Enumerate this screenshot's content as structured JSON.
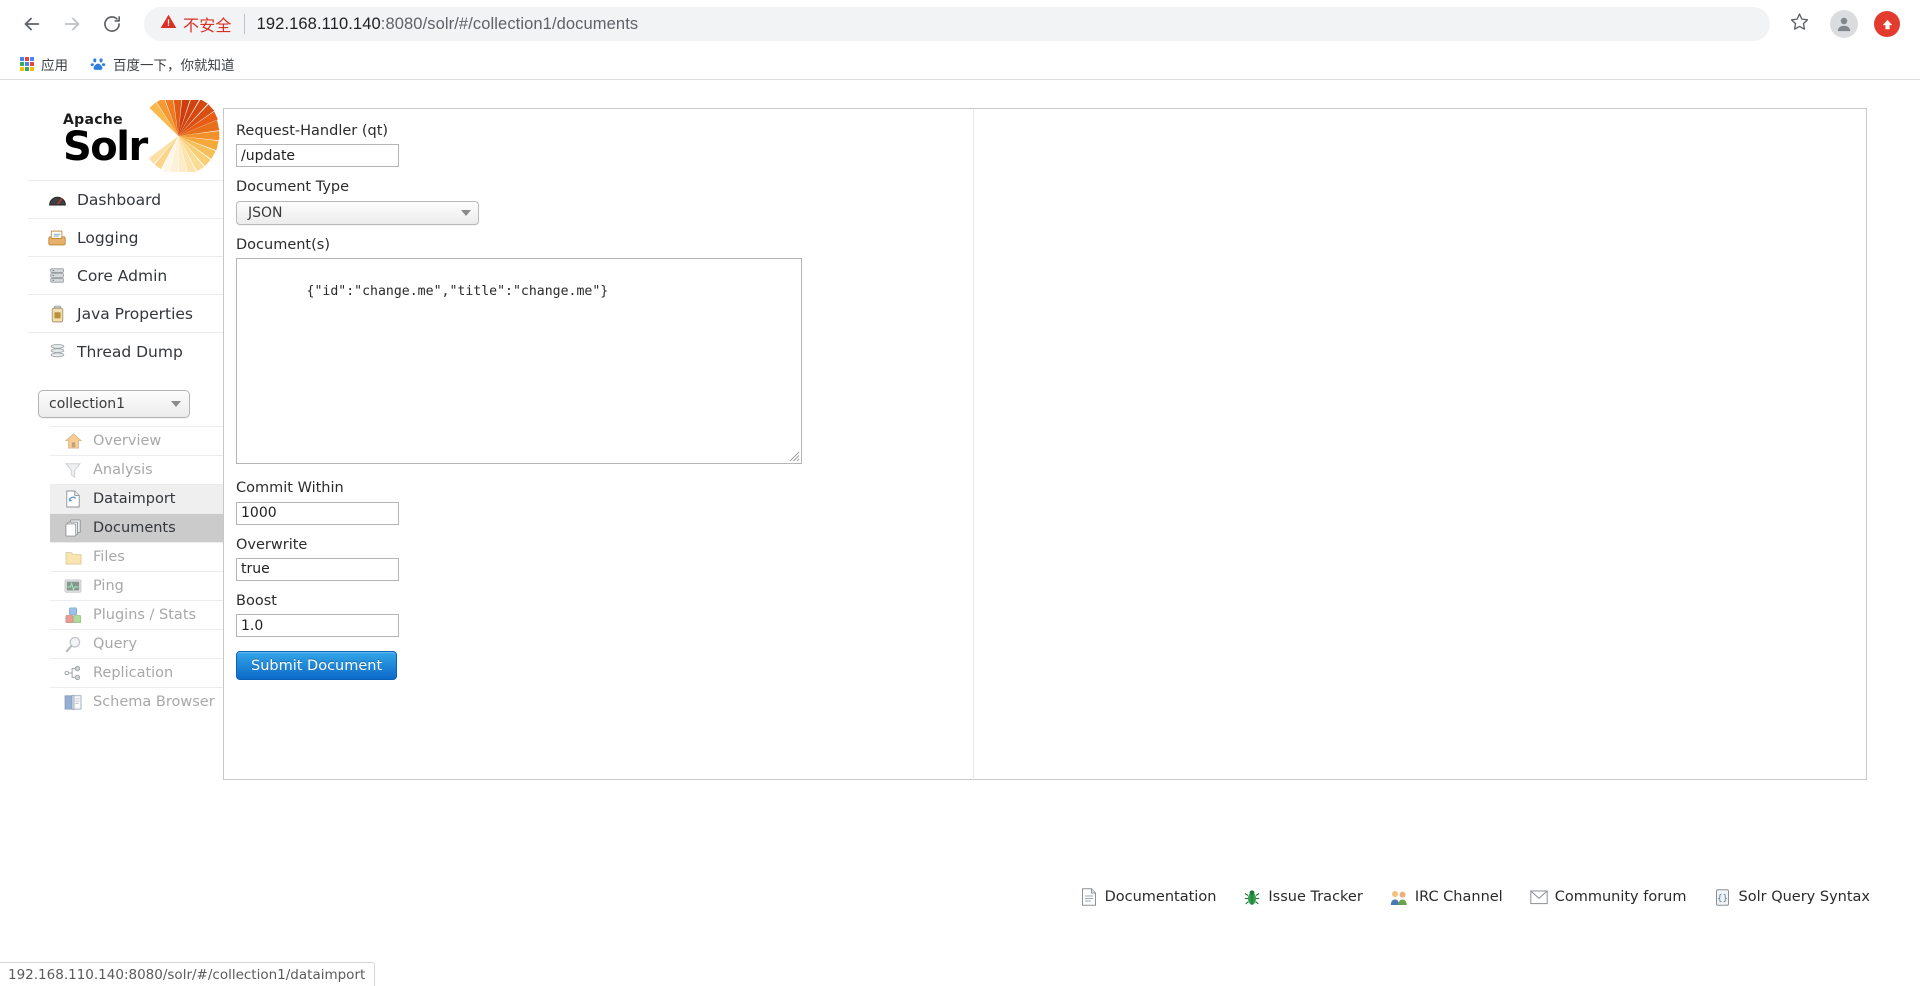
{
  "browser": {
    "back_icon": "back-arrow-icon",
    "forward_icon": "forward-arrow-icon",
    "reload_icon": "reload-icon",
    "security_label": "不安全",
    "url_host": "192.168.110.140",
    "url_port": ":8080",
    "url_path": "/solr/#/collection1/documents",
    "full_url": "192.168.110.140:8080/solr/#/collection1/documents",
    "star_icon": "bookmark-star-icon",
    "profile_icon": "profile-avatar-icon",
    "update_icon": "update-arrow-icon",
    "bookmarks": [
      {
        "label": "应用",
        "icon": "apps-grid-icon"
      },
      {
        "label": "百度一下，你就知道",
        "icon": "baidu-icon"
      }
    ]
  },
  "brand": {
    "apache": "Apache",
    "solr": "Solr"
  },
  "sidebar": {
    "global_items": [
      {
        "label": "Dashboard",
        "icon": "dashboard-gauge-icon"
      },
      {
        "label": "Logging",
        "icon": "logging-tray-icon"
      },
      {
        "label": "Core Admin",
        "icon": "core-admin-server-icon"
      },
      {
        "label": "Java Properties",
        "icon": "java-properties-icon"
      },
      {
        "label": "Thread Dump",
        "icon": "thread-dump-stack-icon"
      }
    ],
    "core_selector": {
      "value": "collection1",
      "chevron_icon": "chevron-down-icon"
    },
    "core_items": [
      {
        "label": "Overview",
        "icon": "overview-home-icon",
        "state": "dim"
      },
      {
        "label": "Analysis",
        "icon": "analysis-funnel-icon",
        "state": "dim"
      },
      {
        "label": "Dataimport",
        "icon": "dataimport-page-icon",
        "state": "hover"
      },
      {
        "label": "Documents",
        "icon": "documents-pages-icon",
        "state": "active"
      },
      {
        "label": "Files",
        "icon": "files-folder-icon",
        "state": "dim"
      },
      {
        "label": "Ping",
        "icon": "ping-monitor-icon",
        "state": "dim"
      },
      {
        "label": "Plugins / Stats",
        "icon": "plugins-blocks-icon",
        "state": "dim"
      },
      {
        "label": "Query",
        "icon": "query-magnifier-icon",
        "state": "dim"
      },
      {
        "label": "Replication",
        "icon": "replication-nodes-icon",
        "state": "dim"
      },
      {
        "label": "Schema Browser",
        "icon": "schema-book-icon",
        "state": "dim"
      }
    ]
  },
  "form": {
    "request_handler": {
      "label": "Request-Handler (qt)",
      "value": "/update"
    },
    "document_type": {
      "label": "Document Type",
      "value": "JSON",
      "chevron_icon": "chevron-down-icon"
    },
    "documents": {
      "label": "Document(s)",
      "value": "{\"id\":\"change.me\",\"title\":\"change.me\"}"
    },
    "commit_within": {
      "label": "Commit Within",
      "value": "1000"
    },
    "overwrite": {
      "label": "Overwrite",
      "value": "true"
    },
    "boost": {
      "label": "Boost",
      "value": "1.0"
    },
    "submit_label": "Submit Document"
  },
  "footer": {
    "links": [
      {
        "label": "Documentation",
        "icon": "document-page-icon"
      },
      {
        "label": "Issue Tracker",
        "icon": "bug-icon"
      },
      {
        "label": "IRC Channel",
        "icon": "people-icon"
      },
      {
        "label": "Community forum",
        "icon": "envelope-icon"
      },
      {
        "label": "Solr Query Syntax",
        "icon": "code-brackets-icon"
      }
    ]
  },
  "status_bar": {
    "text": "192.168.110.140:8080/solr/#/collection1/dataimport"
  },
  "colors": {
    "accent_blue": "#1a7fd4",
    "danger_red": "#d93025",
    "active_row": "#cbcbcb",
    "hover_row": "#efefef"
  }
}
